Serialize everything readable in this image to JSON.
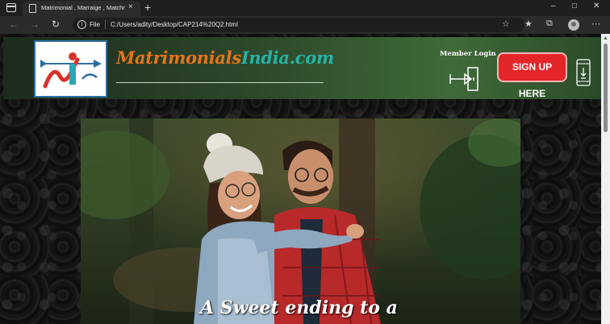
{
  "browser": {
    "tab_title": "Matrimonial , Marraige , Matchmaking",
    "tab_close_icon": "×",
    "new_tab_icon": "+",
    "window_controls": {
      "minimize": "–",
      "maximize": "□",
      "close": "✕"
    },
    "nav": {
      "back": "←",
      "forward": "→",
      "reload": "↻"
    },
    "address": {
      "scheme_label": "File",
      "url": "C:/Users/adity/Desktop/CAP214%20Q2.html"
    },
    "toolbar_icons": {
      "favorite_add": "☆",
      "favorites": "★",
      "collections": "⧉",
      "menu": "⋯"
    }
  },
  "site": {
    "brand_part1": "Matrimonials",
    "brand_part2": "India.com",
    "member_login_label": "Member Login",
    "signup_label": "SIGN UP HERE",
    "hero_caption": "A Sweet ending to a"
  },
  "colors": {
    "brand_orange": "#e8741a",
    "brand_teal": "#26b3a6",
    "signup_red": "#e3262a",
    "header_green": "#3f6a39"
  }
}
